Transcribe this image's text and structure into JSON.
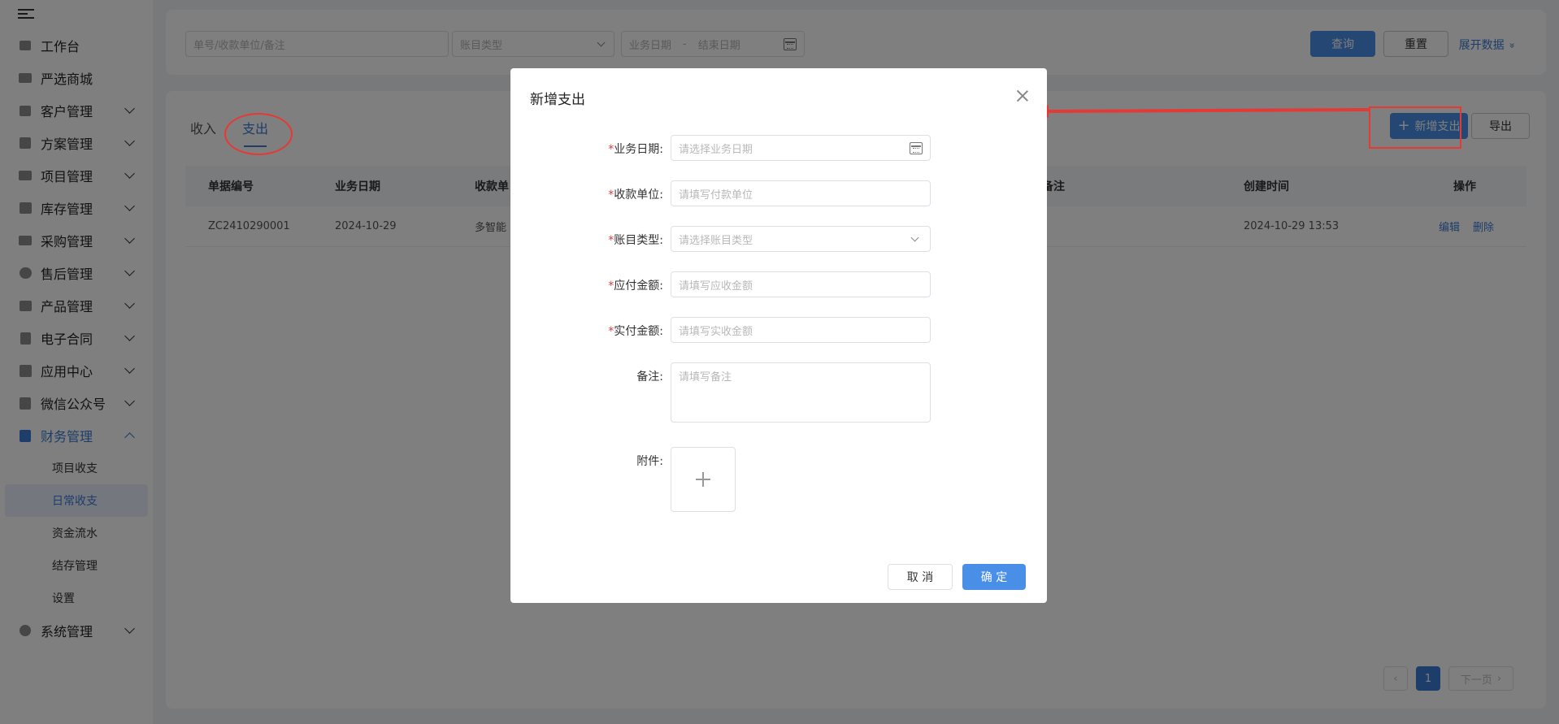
{
  "sidebar": {
    "items": [
      {
        "label": "工作台",
        "icon": "home-icon",
        "has_children": false
      },
      {
        "label": "严选商城",
        "icon": "store-icon",
        "has_children": false
      },
      {
        "label": "客户管理",
        "icon": "customer-icon",
        "has_children": true
      },
      {
        "label": "方案管理",
        "icon": "plan-icon",
        "has_children": true
      },
      {
        "label": "项目管理",
        "icon": "folder-icon",
        "has_children": true
      },
      {
        "label": "库存管理",
        "icon": "inventory-icon",
        "has_children": true
      },
      {
        "label": "采购管理",
        "icon": "cart-icon",
        "has_children": true
      },
      {
        "label": "售后管理",
        "icon": "headset-icon",
        "has_children": true
      },
      {
        "label": "产品管理",
        "icon": "product-icon",
        "has_children": true
      },
      {
        "label": "电子合同",
        "icon": "contract-icon",
        "has_children": true
      },
      {
        "label": "应用中心",
        "icon": "apps-icon",
        "has_children": true
      },
      {
        "label": "微信公众号",
        "icon": "wechat-icon",
        "has_children": true
      },
      {
        "label": "财务管理",
        "icon": "finance-icon",
        "has_children": true,
        "open": true
      }
    ],
    "finance_sub": [
      "项目收支",
      "日常收支",
      "资金流水",
      "结存管理",
      "设置"
    ],
    "active_sub": "日常收支",
    "system": {
      "label": "系统管理",
      "icon": "settings-icon"
    }
  },
  "filters": {
    "search_placeholder": "单号/收款单位/备注",
    "type_placeholder": "账目类型",
    "start_date_placeholder": "业务日期",
    "date_sep": "-",
    "end_date_placeholder": "结束日期",
    "query_label": "查询",
    "reset_label": "重置",
    "expand_label": "展开数据",
    "expand_icon": "»"
  },
  "tabs": [
    {
      "label": "收入",
      "active": false
    },
    {
      "label": "支出",
      "active": true
    }
  ],
  "toolbar": {
    "add_label": "新增支出",
    "add_icon": "+",
    "export_label": "导出"
  },
  "table": {
    "headers": [
      "单据编号",
      "业务日期",
      "收款单",
      "备注",
      "创建时间",
      "操作"
    ],
    "rows": [
      {
        "code": "ZC2410290001",
        "date": "2024-10-29",
        "payee": "多智能",
        "remark": "",
        "created": "2024-10-29 13:53",
        "edit": "编辑",
        "delete": "删除"
      }
    ]
  },
  "pager": {
    "prev": "‹",
    "current": "1",
    "next_label": "下一页",
    "next_icon": "›"
  },
  "dialog": {
    "title": "新增支出",
    "fields": [
      {
        "label": "业务日期:",
        "required": true,
        "placeholder": "请选择业务日期",
        "kind": "date"
      },
      {
        "label": "收款单位:",
        "required": true,
        "placeholder": "请填写付款单位",
        "kind": "text"
      },
      {
        "label": "账目类型:",
        "required": true,
        "placeholder": "请选择账目类型",
        "kind": "select"
      },
      {
        "label": "应付金额:",
        "required": true,
        "placeholder": "请填写应收金额",
        "kind": "text"
      },
      {
        "label": "实付金额:",
        "required": true,
        "placeholder": "请填写实收金额",
        "kind": "text"
      },
      {
        "label": "备注:",
        "required": false,
        "placeholder": "请填写备注",
        "kind": "textarea"
      }
    ],
    "attachment_label": "附件:",
    "cancel_label": "取 消",
    "ok_label": "确 定"
  },
  "colors": {
    "accent": "#3a7bd5",
    "button": "#4a8fe7",
    "annotation": "#e53935"
  }
}
